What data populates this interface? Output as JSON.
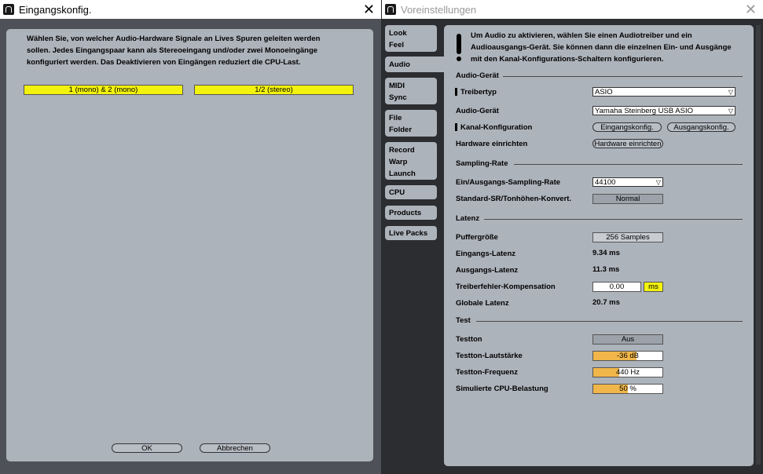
{
  "left_window": {
    "title": "Eingangskonfig.",
    "description_lines": [
      "Wählen Sie, von welcher Audio-Hardware Signale an Lives Spuren geleiten werden",
      "sollen. Jedes Eingangspaar kann als Stereoeingang und/oder zwei Monoeingänge",
      "konfiguriert werden. Das Deaktivieren von Eingängen reduziert die CPU-Last."
    ],
    "channels": [
      "1 (mono) & 2 (mono)",
      "1/2 (stereo)"
    ],
    "ok_label": "OK",
    "cancel_label": "Abbrechen",
    "accent_color": "#f2f20d"
  },
  "right_window": {
    "title": "Voreinstellungen",
    "tabs": [
      {
        "label": "Look\nFeel"
      },
      {
        "label": "Audio"
      },
      {
        "label": "MIDI\nSync"
      },
      {
        "label": "File\nFolder"
      },
      {
        "label": "Record\nWarp\nLaunch"
      },
      {
        "label": "CPU"
      },
      {
        "label": "Products"
      },
      {
        "label": "Live Packs"
      }
    ],
    "info_lines": [
      "Um Audio zu aktivieren, wählen Sie einen Audiotreiber und ein",
      "Audioausgangs-Gerät. Sie können dann die einzelnen Ein- und Ausgänge",
      "mit den Kanal-Konfigurations-Schaltern konfigurieren."
    ],
    "sections": {
      "audio_device": "Audio-Gerät",
      "sampling": "Sampling-Rate",
      "latency": "Latenz",
      "test": "Test"
    },
    "labels": {
      "driver_type": "Treibertyp",
      "audio_device": "Audio-Gerät",
      "channel_config": "Kanal-Konfiguration",
      "hardware_setup": "Hardware einrichten",
      "io_sample_rate": "Ein/Ausgangs-Sampling-Rate",
      "default_sr": "Standard-SR/Tonhöhen-Konvert.",
      "buffer_size": "Puffergröße",
      "input_latency": "Eingangs-Latenz",
      "output_latency": "Ausgangs-Latenz",
      "driver_error_comp": "Treiberfehler-Kompensation",
      "overall_latency": "Globale Latenz",
      "test_tone": "Testton",
      "test_volume": "Testton-Lautstärke",
      "test_freq": "Testton-Frequenz",
      "cpu_load": "Simulierte CPU-Belastung"
    },
    "values": {
      "driver_type": "ASIO",
      "audio_device": "Yamaha Steinberg USB ASIO",
      "input_config_btn": "Eingangskonfig.",
      "output_config_btn": "Ausgangskonfig.",
      "hardware_setup_btn": "Hardware einrichten",
      "io_sample_rate": "44100",
      "default_sr": "Normal",
      "buffer_size": "256 Samples",
      "input_latency": "9.34 ms",
      "output_latency": "11.3 ms",
      "driver_error_comp": "0.00",
      "driver_error_unit": "ms",
      "overall_latency": "20.7 ms",
      "test_tone": "Aus",
      "test_volume": "-36 dB",
      "test_volume_fill": 0.62,
      "test_freq": "440 Hz",
      "test_freq_fill": 0.38,
      "cpu_load": "50 %",
      "cpu_load_fill": 0.5
    },
    "fill_color": "#f0b64a"
  }
}
